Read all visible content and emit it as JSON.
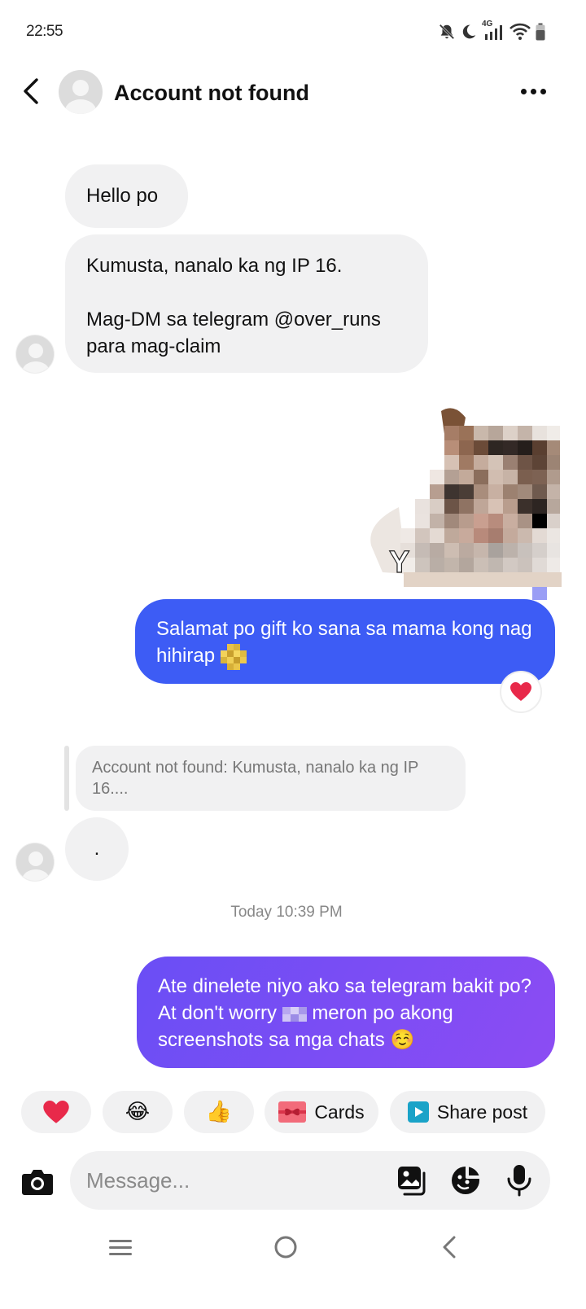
{
  "status_bar": {
    "time": "22:55",
    "network_label": "4G",
    "icons": [
      "mute-bell-icon",
      "moon-icon",
      "signal-icon",
      "wifi-icon",
      "battery-icon"
    ]
  },
  "header": {
    "title": "Account not found",
    "back_icon": "chevron-left-icon",
    "more_icon": "more-horizontal-icon"
  },
  "messages": [
    {
      "direction": "incoming",
      "text": "Hello po"
    },
    {
      "direction": "incoming",
      "lines": [
        "Kumusta, nanalo ka ng IP 16.",
        "Mag-DM sa telegram @over_runs para mag-claim"
      ]
    },
    {
      "direction": "outgoing",
      "type": "sticker",
      "description": "pixelated sticker"
    },
    {
      "direction": "outgoing",
      "text": "Salamat po gift ko sana sa mama kong nag hihirap",
      "reaction": "heart",
      "bubble_color": "#3d5cf5"
    },
    {
      "direction": "incoming",
      "reply_to": "Account not found: Kumusta, nanalo ka ng IP 16....",
      "text": "."
    },
    {
      "direction": "outgoing",
      "text_a": "Ate dinelete niyo ako sa telegram bakit po? At don't worry",
      "text_b": "meron po akong screenshots sa mga chats",
      "emoji": "☺️"
    }
  ],
  "timestamp": "Today 10:39 PM",
  "quick_replies": [
    {
      "emoji": "❤️",
      "icon": "heart-icon"
    },
    {
      "emoji": "😂",
      "icon": "laugh-cry-icon"
    },
    {
      "emoji": "👍",
      "icon": "thumbs-up-icon"
    },
    {
      "label": "Cards",
      "icon": "gift-card-icon"
    },
    {
      "label": "Share post",
      "icon": "share-post-icon"
    }
  ],
  "composer": {
    "placeholder": "Message...",
    "icons": [
      "camera-icon",
      "gallery-icon",
      "sticker-icon",
      "microphone-icon"
    ]
  },
  "nav_bar": {
    "icons": [
      "recents-icon",
      "home-icon",
      "back-icon"
    ]
  },
  "colors": {
    "outgoing_blue": "#3d5cf5",
    "outgoing_purple": "#8c4cf3",
    "incoming_bubble": "#f1f1f2",
    "heart_red": "#e8294a"
  }
}
